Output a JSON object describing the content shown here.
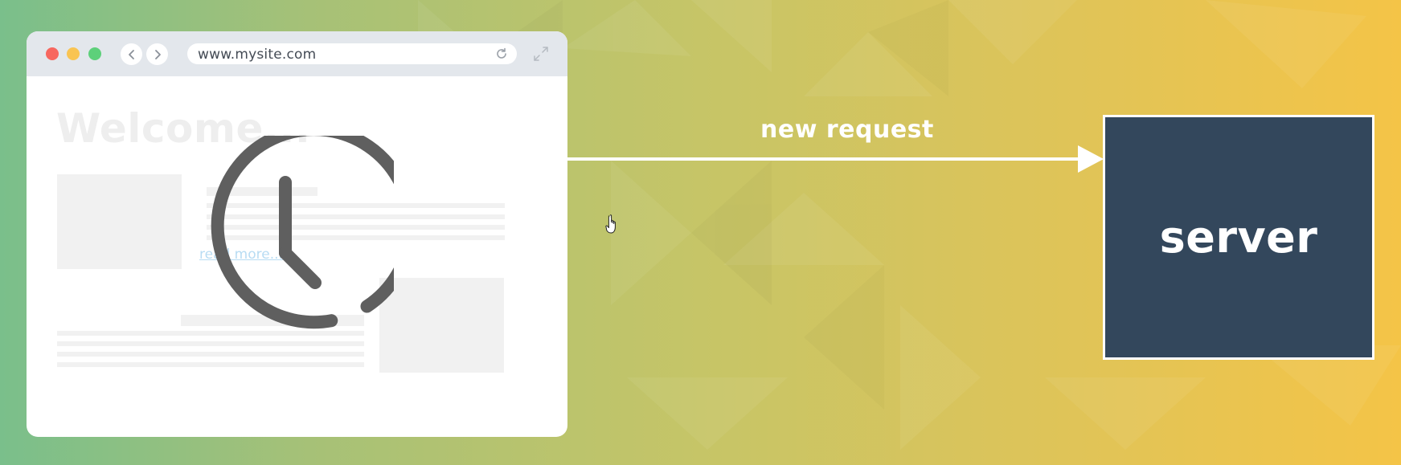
{
  "browser": {
    "url": "www.mysite.com",
    "heading": "Welcome...",
    "link_text": "read more...",
    "window_controls": [
      "close-dot",
      "minimize-dot",
      "maximize-dot"
    ],
    "icons": [
      "back-icon",
      "forward-icon",
      "reload-icon",
      "expand-icon",
      "clock-icon"
    ]
  },
  "arrow": {
    "label": "new request"
  },
  "server": {
    "label": "server"
  },
  "colors": {
    "server_fill": "#33475c",
    "gradient_start": "#7abf8b",
    "gradient_end": "#f4c447",
    "clock_stroke": "#5f5f5f",
    "link": "#b8dcf3"
  }
}
